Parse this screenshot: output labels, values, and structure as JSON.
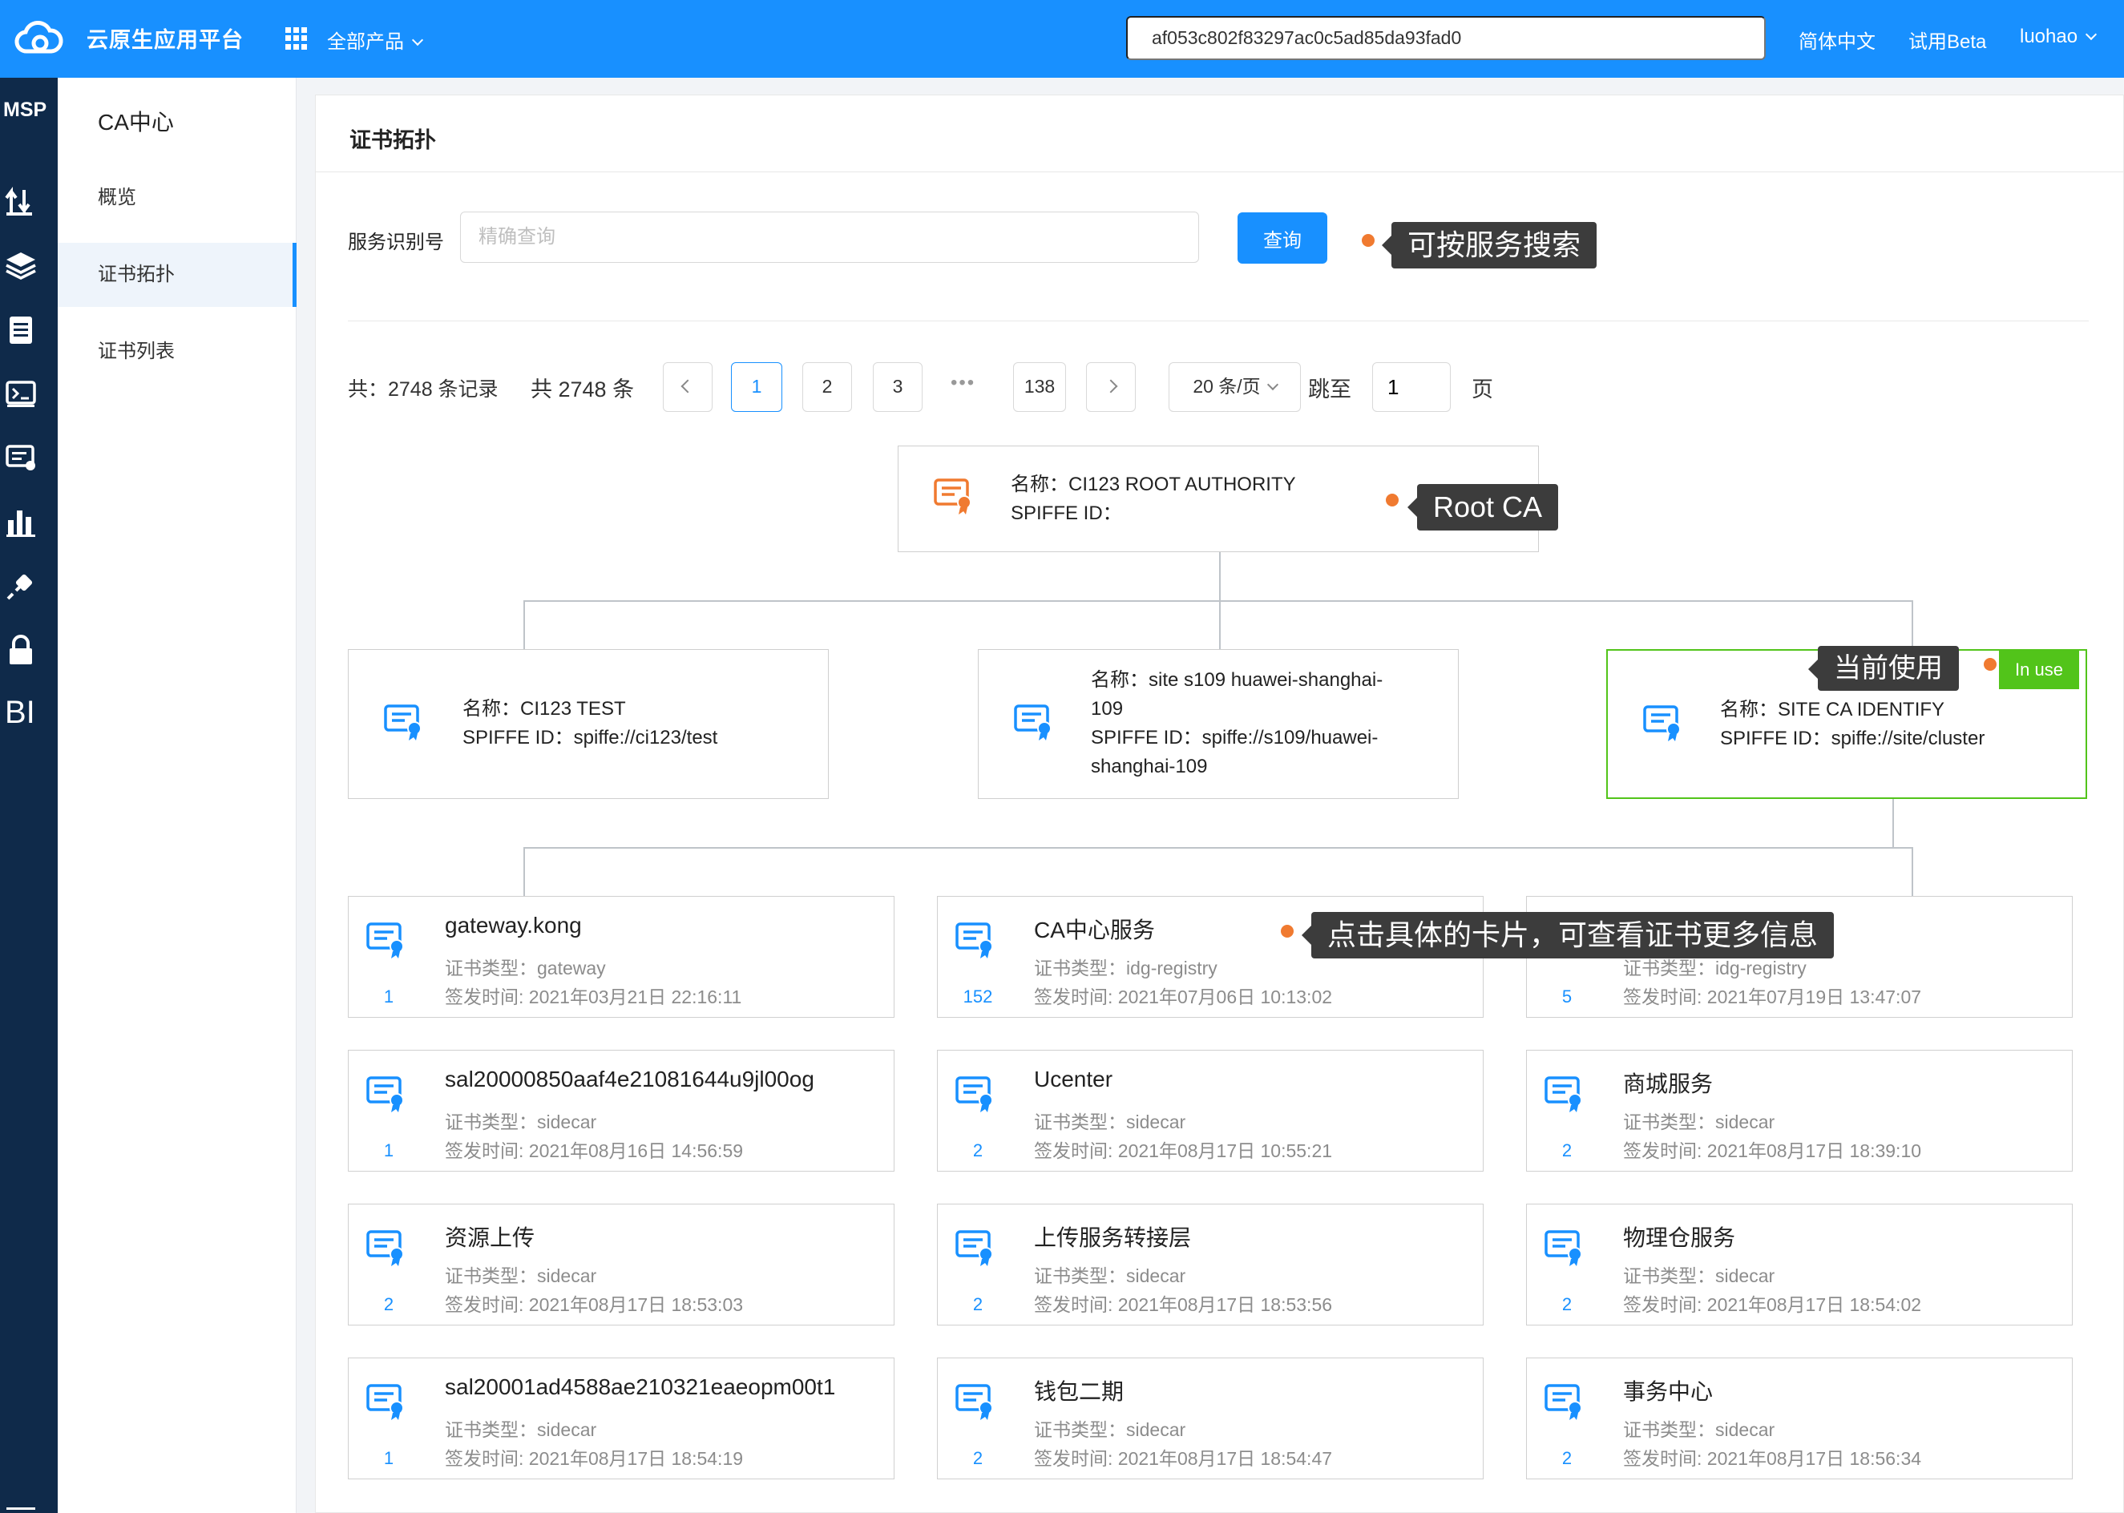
{
  "topbar": {
    "brand": "云原生应用平台",
    "all_products": "全部产品",
    "search_value": "af053c802f83297ac0c5ad85da93fad0",
    "lang": "简体中文",
    "beta": "试用Beta",
    "user": "luohao"
  },
  "msp": {
    "label": "MSP",
    "bi": "BI"
  },
  "subnav": {
    "title": "CA中心",
    "items": [
      {
        "label": "概览"
      },
      {
        "label": "证书拓扑"
      },
      {
        "label": "证书列表"
      }
    ]
  },
  "page": {
    "title": "证书拓扑",
    "search_label": "服务识别号",
    "search_placeholder": "精确查询",
    "search_button": "查询",
    "tip_search": "可按服务搜索",
    "tip_root": "Root CA",
    "tip_current": "当前使用",
    "tip_card": "点击具体的卡片，可查看证书更多信息"
  },
  "pagination": {
    "total_left": "共：2748 条记录",
    "total_right": "共 2748 条",
    "pages": [
      "1",
      "2",
      "3",
      "138"
    ],
    "ellipsis": "•••",
    "page_size": "20 条/页",
    "jump_label": "跳至",
    "jump_value": "1",
    "page_suffix": "页"
  },
  "root_ca": {
    "name": "名称：CI123 ROOT AUTHORITY",
    "spiffe": "SPIFFE ID："
  },
  "intermediate": [
    {
      "line1": "名称：CI123 TEST",
      "line2": "SPIFFE ID：spiffe://ci123/test"
    },
    {
      "line1": "名称：site s109 huawei-shanghai-",
      "line2": "109",
      "line3": "SPIFFE ID：spiffe://s109/huawei-",
      "line4": "shanghai-109"
    },
    {
      "line1": "名称：SITE CA IDENTIFY",
      "line2": "SPIFFE ID：spiffe://site/cluster",
      "badge": "In use"
    }
  ],
  "services": [
    {
      "name": "gateway.kong",
      "type": "证书类型：gateway",
      "time": "签发时间: 2021年03月21日 22:16:11",
      "count": "1"
    },
    {
      "name": "CA中心服务",
      "type": "证书类型：idg-registry",
      "time": "签发时间: 2021年07月06日 10:13:02",
      "count": "152"
    },
    {
      "name": "",
      "type": "证书类型：idg-registry",
      "time": "签发时间: 2021年07月19日 13:47:07",
      "count": "5"
    },
    {
      "name": "sal20000850aaf4e21081644u9jl00og",
      "type": "证书类型：sidecar",
      "time": "签发时间: 2021年08月16日 14:56:59",
      "count": "1"
    },
    {
      "name": "Ucenter",
      "type": "证书类型：sidecar",
      "time": "签发时间: 2021年08月17日 10:55:21",
      "count": "2"
    },
    {
      "name": "商城服务",
      "type": "证书类型：sidecar",
      "time": "签发时间: 2021年08月17日 18:39:10",
      "count": "2"
    },
    {
      "name": "资源上传",
      "type": "证书类型：sidecar",
      "time": "签发时间: 2021年08月17日 18:53:03",
      "count": "2"
    },
    {
      "name": "上传服务转接层",
      "type": "证书类型：sidecar",
      "time": "签发时间: 2021年08月17日 18:53:56",
      "count": "2"
    },
    {
      "name": "物理仓服务",
      "type": "证书类型：sidecar",
      "time": "签发时间: 2021年08月17日 18:54:02",
      "count": "2"
    },
    {
      "name": "sal20001ad4588ae210321eaeopm00t1",
      "type": "证书类型：sidecar",
      "time": "签发时间: 2021年08月17日 18:54:19",
      "count": "1"
    },
    {
      "name": "钱包二期",
      "type": "证书类型：sidecar",
      "time": "签发时间: 2021年08月17日 18:54:47",
      "count": "2"
    },
    {
      "name": "事务中心",
      "type": "证书类型：sidecar",
      "time": "签发时间: 2021年08月17日 18:56:34",
      "count": "2"
    }
  ],
  "colors": {
    "primary": "#1890ff",
    "success": "#52c41a",
    "root_icon": "#f07a30",
    "sidebar": "#0f2a4a"
  }
}
